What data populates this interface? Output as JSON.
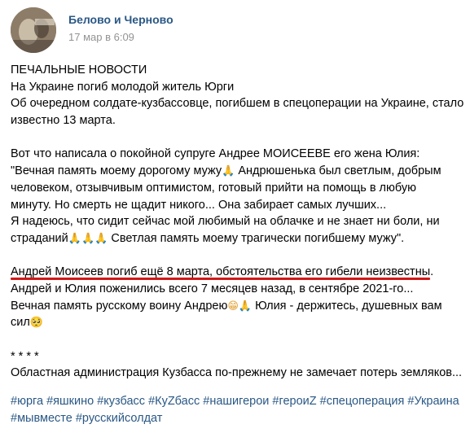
{
  "post": {
    "author": "Белово и Черново",
    "time": "17 мар в 6:09",
    "lines": [
      "ПЕЧАЛЬНЫЕ НОВОСТИ",
      "На Украине погиб молодой житель Юрги",
      "Об очередном солдате-кузбассовце, погибшем в спецоперации на Украине, стало",
      "известно 13 марта.",
      "",
      "Вот что написала о покойной супруге Андрее МОИСЕЕВЕ его жена Юлия:",
      "\"Вечная память моему дорогому мужу",
      " Андрюшенька был светлым, добрым",
      "человеком, отзывчивым оптимистом, готовый прийти на помощь в любую",
      "минуту. Но смерть не щадит никого... Она забирает самых лучших...",
      "Я надеюсь, что сидит сейчас мой любимый на облачке и не знает ни боли, ни",
      "страданий",
      " Светлая память моему трагически погибшему мужу\".",
      "",
      "Андрей Моисеев погиб ещё 8 марта, обстоятельства его гибели неизвестны.",
      "Андрей и Юлия поженились всего 7 месяцев назад, в сентябре 2021-го...",
      "Вечная память русскому воину Андрею",
      " Юлия - держитесь, душевных вам",
      "сил",
      "",
      "* * * *",
      "Областная администрация Кузбасса по-прежнему не замечает потерь земляков..."
    ],
    "emoji": {
      "pray": "🙏",
      "pray3": "🙏🙏🙏",
      "grin_pray": "😁🙏",
      "pleading": "🥺"
    },
    "hashtags": [
      "#юрга",
      "#яшкино",
      "#кузбасс",
      "#КуZбасс",
      "#нашигерои",
      "#героиZ",
      "#спецоперация",
      "#Украина",
      "#мывместе",
      "#русскийсолдат"
    ]
  }
}
